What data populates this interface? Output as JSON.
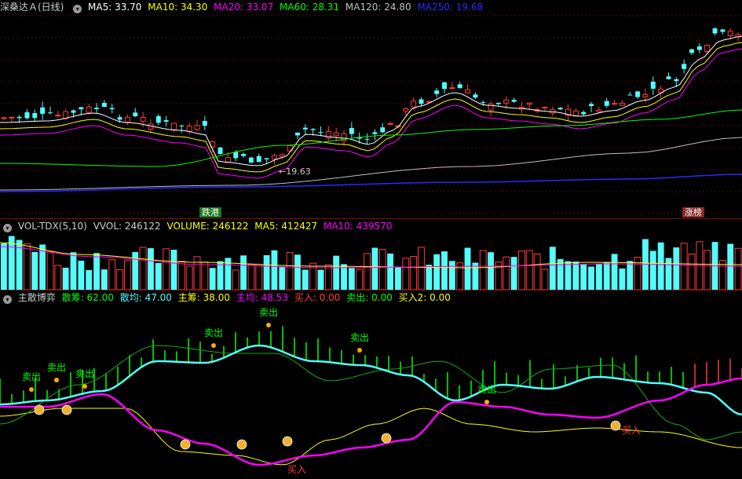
{
  "main": {
    "title": "深桑达Ａ(日线)",
    "ma5": "MA5: 33.70",
    "ma10": "MA10: 34.30",
    "ma20": "MA20: 33.07",
    "ma60": "MA60: 28.31",
    "ma120": "MA120: 24.80",
    "ma250": "MA250: 19.68",
    "low_price": "19.63",
    "low_arrow": "←",
    "tag_left": "跌港",
    "tag_right": "涨榜"
  },
  "volume": {
    "name": "VOL-TDX(5,10)",
    "vvol": "VVOL: 246122",
    "volume": "VOLUME: 246122",
    "ma5": "MA5: 412427",
    "ma10": "MA10: 439570"
  },
  "indicator": {
    "name": "主散博弈",
    "sanchou": "散筹: 62.00",
    "sanjun": "散均: 47.00",
    "zhuchou": "主筹: 38.00",
    "zhujun": "主均: 48.53",
    "buy": "买入: 0.00",
    "sell": "卖出: 0.00",
    "buy2": "买入2: 0.00",
    "sell_label": "卖出",
    "buy_label": "买入"
  },
  "colors": {
    "up": "#ff3b3b",
    "down": "#54fcfc",
    "ma5": "#ffffff",
    "ma10": "#ffff00",
    "ma20": "#ff00ff",
    "ma60": "#00ff00",
    "ma120": "#c0c0c0",
    "ma250": "#0000ff"
  },
  "icons": [
    "chevron-circle-icon",
    "runner-icon",
    "money-bag-icon"
  ]
}
